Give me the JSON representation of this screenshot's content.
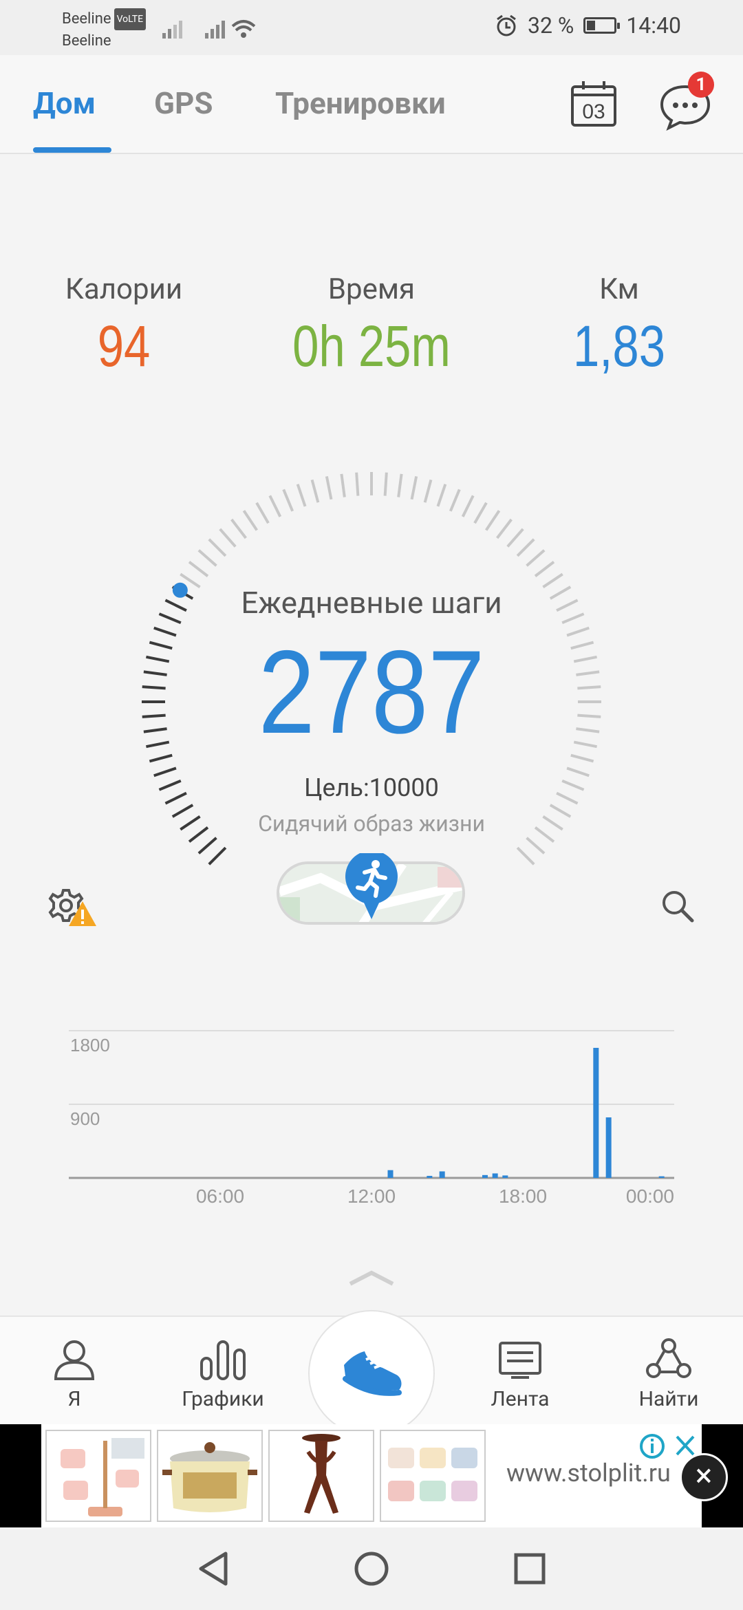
{
  "status_bar": {
    "carrier1": "Beeline",
    "volte": "VoLTE",
    "carrier2": "Beeline",
    "battery": "32 %",
    "time": "14:40"
  },
  "tabs": [
    {
      "label": "Дом",
      "active": true
    },
    {
      "label": "GPS",
      "active": false
    },
    {
      "label": "Тренировки",
      "active": false
    }
  ],
  "calendar_day": "03",
  "messages_badge": "1",
  "stats": {
    "calories": {
      "label": "Калории",
      "value": "94",
      "color": "#e8652b"
    },
    "time": {
      "label": "Время",
      "value": "0h 25m",
      "color": "#7cb342"
    },
    "km": {
      "label": "Км",
      "value": "1,83",
      "color": "#2d86d6"
    }
  },
  "daily_steps": {
    "title": "Ежедневные шаги",
    "value": "2787",
    "goal_label": "Цель:10000",
    "status": "Сидячий образ жизни",
    "progress": 0.2787
  },
  "chart_data": {
    "type": "bar",
    "y_ticks": [
      "1800",
      "900"
    ],
    "x_ticks": [
      "06:00",
      "12:00",
      "18:00",
      "00:00"
    ],
    "ylim": [
      0,
      1800
    ],
    "xlim_hours": [
      0,
      24
    ],
    "bars": [
      {
        "hour": 12.75,
        "value": 95
      },
      {
        "hour": 14.3,
        "value": 25
      },
      {
        "hour": 14.8,
        "value": 80
      },
      {
        "hour": 16.5,
        "value": 35
      },
      {
        "hour": 16.9,
        "value": 55
      },
      {
        "hour": 17.3,
        "value": 30
      },
      {
        "hour": 20.9,
        "value": 1590
      },
      {
        "hour": 21.4,
        "value": 740
      },
      {
        "hour": 23.5,
        "value": 20
      }
    ],
    "color": "#2d86d6"
  },
  "bottom_nav": [
    {
      "label": "Я",
      "icon": "person-icon"
    },
    {
      "label": "Графики",
      "icon": "bar-chart-icon"
    },
    {
      "label": "Лента",
      "icon": "feed-icon"
    },
    {
      "label": "Найти",
      "icon": "find-icon"
    }
  ],
  "ad": {
    "site": "www.stolplit.ru"
  }
}
